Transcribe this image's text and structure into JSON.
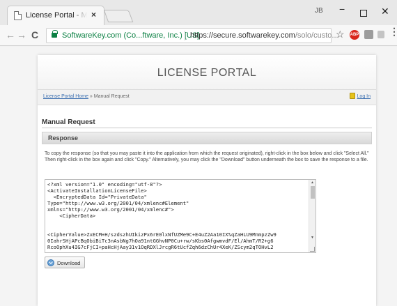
{
  "browser": {
    "tab_title": "License Portal - Manual R",
    "tab_close": "×",
    "window_badge": "JB",
    "min_glyph": "−",
    "close_glyph": "✕",
    "site_identity": "SoftwareKey.com (Co...ftware, Inc.) [US]",
    "url_host": "https://secure.softwarekey.com",
    "url_path": "/solo/custo...",
    "ext_label": "ABP",
    "colors": {
      "secure": "#0b8043",
      "ext_red": "#d9261c"
    }
  },
  "nav": {
    "back": "←",
    "forward": "→",
    "reload": "C",
    "star": "☆",
    "menu": "⋮"
  },
  "portal": {
    "title": "LICENSE PORTAL",
    "breadcrumb_home": "License Portal Home",
    "breadcrumb_sep": " » ",
    "breadcrumb_current": "Manual Request",
    "login": "Log In",
    "section_title": "Manual Request",
    "response_label": "Response",
    "instructions": "To copy the response (so that you may paste it into the application from which the request originated), right-click in the box below and click \"Select All.\" Then right-click in the box again and click \"Copy.\" Alternatively, you may click the \"Download\" button underneath the box to save the response to a file.",
    "response_text": "<?xml version=\"1.0\" encoding=\"utf-8\"?>\n<ActivateInstallationLicenseFile>\n  <EncryptedData Id=\"PrivateData\"\nType=\"http://www.w3.org/2001/04/xmlenc#Element\"\nxmlns=\"http://www.w3.org/2001/04/xmlenc#\">\n    <CipherData>\n\n\n<CipherValue>ZxECM+H/szdszhUIkizPx6rE0lxNfUZMe9C+E4uZ2Aa10IX%qZaHLU9MnmpzZw9\n0IahrSHjAPcBqObiBiTc3nAsbNg7hOa91ntGGhvNP0Cu+rw/sKbs0AfgwmvdF/El/AhmT/R2+g6\nRcoOphXu4IG7cFjCI+paHcHjAay31v1OqRDXlJrcgR6tUcfZqh6dzChUr4XeK/ZScym2qTOHvL2",
    "download_label": "Download"
  }
}
